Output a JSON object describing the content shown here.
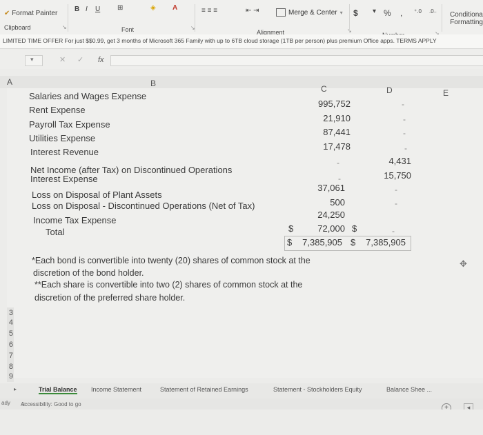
{
  "ribbon": {
    "format_painter": "Format Painter",
    "bold": "B",
    "italic": "I",
    "underline": "U",
    "merge_center": "Merge & Center",
    "currency": "$",
    "percent": "%",
    "comma": ",",
    "conditional": "Conditional",
    "formatting": "Formatting",
    "clipboard": "Clipboard",
    "font": "Font",
    "alignment": "Alignment",
    "number": "Number"
  },
  "banner": {
    "text": "LIMITED TIME OFFER  For just $$0.99, get 3 months of Microsoft 365 Family with up to 6TB cloud storage (1TB per person) plus premium Office apps. TERMS APPLY"
  },
  "formula_bar": {
    "fx": "fx"
  },
  "columns": [
    "A",
    "B",
    "C",
    "D",
    "E"
  ],
  "rows": [
    {
      "label": "Salaries and Wages Expense",
      "c": "995,752",
      "d": ""
    },
    {
      "label": "Rent Expense",
      "c": "21,910",
      "d": ""
    },
    {
      "label": "Payroll Tax Expense",
      "c": "87,441",
      "d": ""
    },
    {
      "label": "Utilities Expense",
      "c": "17,478",
      "d": ""
    },
    {
      "label": "Interest Revenue",
      "c": "",
      "d": ""
    },
    {
      "label": "Net Income (after Tax) on Discontinued Operations",
      "c": "",
      "d": "4,431"
    },
    {
      "label": "Interest Expense",
      "c": "",
      "d": "15,750"
    },
    {
      "label": "Loss on Disposal of Plant Assets",
      "c": "37,061",
      "d": ""
    },
    {
      "label": "Loss on Disposal - Discontinued Operations (Net of Tax)",
      "c": "500",
      "d": ""
    },
    {
      "label": "Income Tax Expense",
      "c": "24,250",
      "d": ""
    }
  ],
  "income_tax_row": {
    "c_prefix": "$",
    "c": "72,000",
    "d_prefix": "$"
  },
  "total_row": {
    "label": "Total",
    "c_prefix": "$",
    "c": "7,385,905",
    "d_prefix": "$",
    "d": "7,385,905"
  },
  "notes": {
    "note1_line1": "*Each bond is convertible into twenty (20) shares of common stock at the",
    "note1_line2": "discretion of the bond holder.",
    "note2_line1": "**Each share is convertible into two (2) shares of common stock at the",
    "note2_line2": "discretion of the preferred share holder."
  },
  "row_numbers": [
    "3",
    "4",
    "5",
    "6",
    "7",
    "8",
    "9"
  ],
  "tabs": [
    "Trial Balance",
    "Income Statement",
    "Statement of Retained Earnings",
    "Statement - Stockholders Equity",
    "Balance Shee ..."
  ],
  "status": {
    "ready": "ady",
    "accessibility": "Accessibility: Good to go"
  },
  "icons": {
    "add_sheet": "plus-circle-icon",
    "scroll": "arrow-left-icon"
  }
}
